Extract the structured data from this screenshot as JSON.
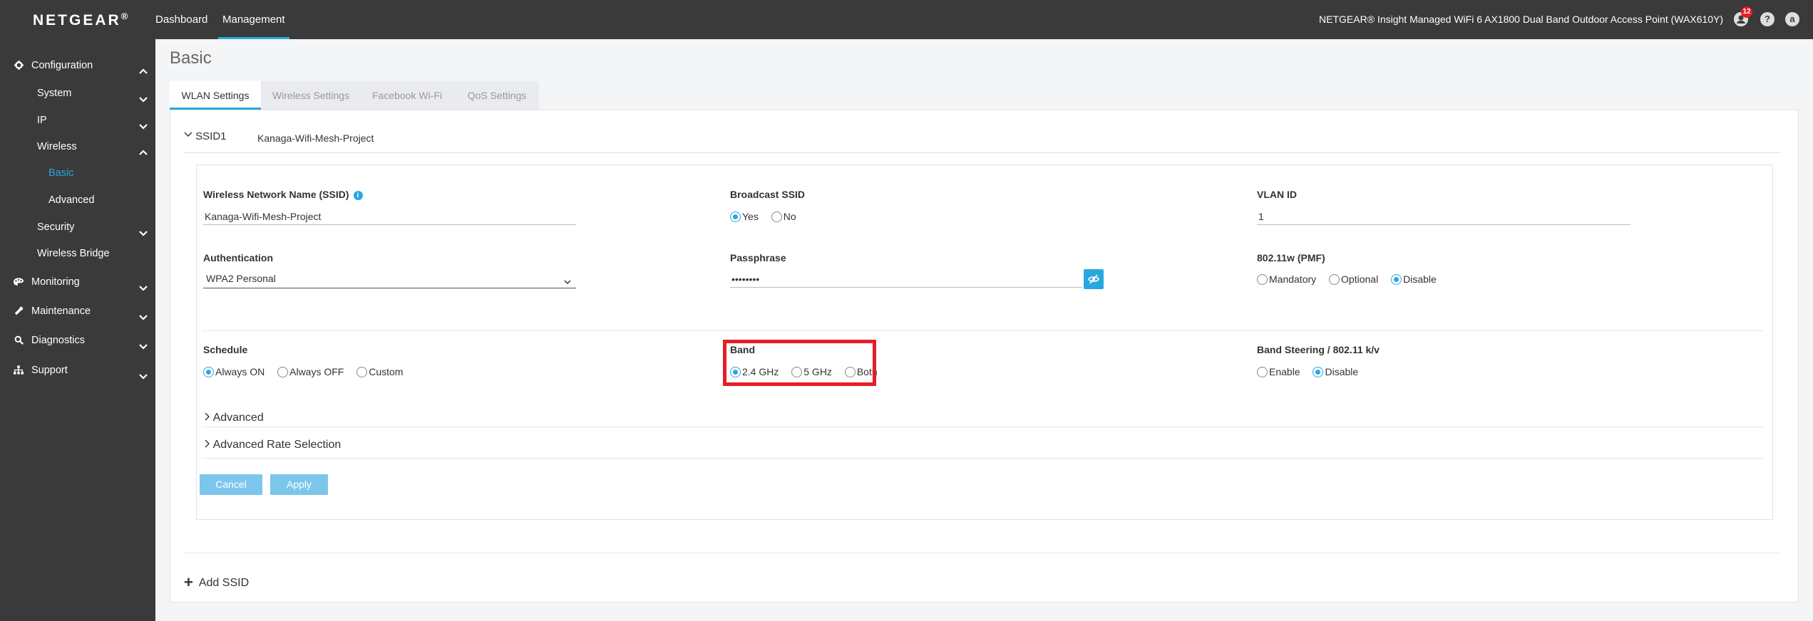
{
  "header": {
    "logo": "NETGEAR",
    "logo_mark": "®",
    "nav": [
      {
        "label": "Dashboard"
      },
      {
        "label": "Management"
      }
    ],
    "device_title": "NETGEAR® Insight Managed WiFi 6 AX1800 Dual Band Outdoor Access Point (WAX610Y)",
    "notification_count": "12",
    "help_glyph": "?",
    "user_glyph": "a"
  },
  "sidebar": {
    "items": [
      {
        "label": "Configuration",
        "icon": "gear-icon"
      },
      {
        "label": "System"
      },
      {
        "label": "IP"
      },
      {
        "label": "Wireless"
      },
      {
        "label": "Basic"
      },
      {
        "label": "Advanced"
      },
      {
        "label": "Security"
      },
      {
        "label": "Wireless Bridge"
      },
      {
        "label": "Monitoring",
        "icon": "palette-icon"
      },
      {
        "label": "Maintenance",
        "icon": "wrench-icon"
      },
      {
        "label": "Diagnostics",
        "icon": "search-icon"
      },
      {
        "label": "Support",
        "icon": "sitemap-icon"
      }
    ]
  },
  "main": {
    "page_title": "Basic",
    "tabs": [
      {
        "label": "WLAN Settings"
      },
      {
        "label": "Wireless Settings"
      },
      {
        "label": "Facebook Wi-Fi"
      },
      {
        "label": "QoS Settings"
      }
    ],
    "ssid": {
      "heading": "SSID1",
      "name": "Kanaga-Wifi-Mesh-Project"
    },
    "form": {
      "ssid_label": "Wireless Network Name (SSID)",
      "ssid_value": "Kanaga-Wifi-Mesh-Project",
      "broadcast_label": "Broadcast SSID",
      "broadcast_yes": "Yes",
      "broadcast_no": "No",
      "vlan_label": "VLAN ID",
      "vlan_value": "1",
      "auth_label": "Authentication",
      "auth_value": "WPA2 Personal",
      "pass_label": "Passphrase",
      "pass_value": "••••••••",
      "pmf_label": "802.11w (PMF)",
      "pmf_mandatory": "Mandatory",
      "pmf_optional": "Optional",
      "pmf_disable": "Disable",
      "schedule_label": "Schedule",
      "schedule_on": "Always ON",
      "schedule_off": "Always OFF",
      "schedule_custom": "Custom",
      "band_label": "Band",
      "band_24": "2.4 GHz",
      "band_5": "5 GHz",
      "band_both": "Both",
      "steering_label": "Band Steering / 802.11 k/v",
      "steering_enable": "Enable",
      "steering_disable": "Disable",
      "advanced_label": "Advanced",
      "rate_label": "Advanced Rate Selection",
      "cancel_label": "Cancel",
      "apply_label": "Apply"
    },
    "add_ssid_label": "Add SSID"
  },
  "colors": {
    "accent": "#2ba7df",
    "topbar": "#3a3a3a",
    "highlight": "#e41e25"
  }
}
